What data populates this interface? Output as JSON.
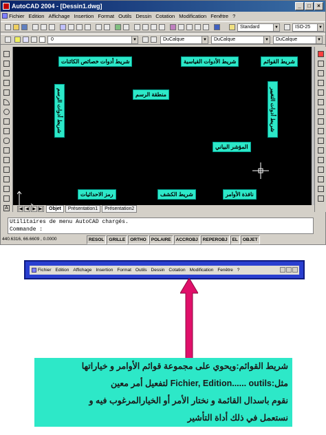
{
  "window": {
    "title": "AutoCAD 2004 - [Dessin1.dwg]",
    "controls": [
      "_",
      "□",
      "×"
    ]
  },
  "menubar": [
    "Fichier",
    "Edition",
    "Affichage",
    "Insertion",
    "Format",
    "Outils",
    "Dessin",
    "Cotation",
    "Modification",
    "Fenêtre",
    "?"
  ],
  "toolbar": {
    "text_style": "Standard",
    "dim_style": "ISO-25",
    "linetype1": "DuCalque",
    "linetype2": "DuCalque",
    "lineweight": "DuCalque",
    "layer": "0"
  },
  "drawing": {
    "labels": {
      "properties_bar": "شريط أدوات خصائص الكائنات",
      "standard_bar": "شريط الأدوات القياسية",
      "menu_bar": "شريط القوائم",
      "draw_bar": "شريط أدوات الرسم",
      "modify_bar": "شريط أدوات التغيير",
      "drawing_area": "منطقة الرسم",
      "cursor": "المؤشر البياني",
      "ucs_symbol": "رمز الاحداثيات",
      "status_bar": "شريط الكشف",
      "command_window": "نافذة الأوامر"
    }
  },
  "tabs": [
    "Objet",
    "Présentation1",
    "Présentation2"
  ],
  "command_lines": [
    "Utilitaires de menu AutoCAD chargés.",
    "Commande :"
  ],
  "status": {
    "coords": "440.6316, 66.6609 , 0.0000",
    "buttons": [
      "RESOL",
      "GRILLE",
      "ORTHO",
      "POLAIRE",
      "ACCROBJ",
      "REPEROBJ",
      "EL",
      "OBJET"
    ]
  },
  "menu_crop": {
    "items": [
      "Fichier",
      "Edition",
      "Affichage",
      "Insertion",
      "Format",
      "Outils",
      "Dessin",
      "Cotation",
      "Modification",
      "Fenêtre",
      "?"
    ]
  },
  "caption": {
    "line1": "شريط القوائم:ويحوي على مجموعة قوائم الأوامر و خياراتها",
    "line2": "مثل:Fichier, Edition...... outils لتفعيل أمر معين",
    "line3": "نقوم باسدال القائمة و نختار الأمر أو الخيارالمرغوب فيه و",
    "line4": "نستعمل في ذلك أداة التأشير"
  },
  "colors": {
    "label_bg": "#2de8c8",
    "title_bar": "#0a246a",
    "frame_blue": "#2a3fd0",
    "arrow": "#e0106a"
  }
}
